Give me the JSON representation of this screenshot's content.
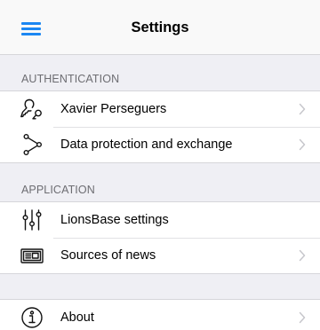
{
  "header": {
    "title": "Settings"
  },
  "sections": [
    {
      "title": "AUTHENTICATION",
      "items": [
        {
          "label": "Xavier Perseguers",
          "icon": "user-key-icon",
          "chevron": true
        },
        {
          "label": "Data protection and exchange",
          "icon": "share-nodes-icon",
          "chevron": true
        }
      ]
    },
    {
      "title": "APPLICATION",
      "items": [
        {
          "label": "LionsBase settings",
          "icon": "sliders-icon",
          "chevron": false
        },
        {
          "label": "Sources of news",
          "icon": "newspaper-icon",
          "chevron": true
        }
      ]
    },
    {
      "title": "",
      "items": [
        {
          "label": "About",
          "icon": "info-circle-icon",
          "chevron": true
        }
      ]
    }
  ],
  "colors": {
    "accent": "#1b87f2",
    "background": "#efeff4",
    "section_text": "#6d6d72",
    "chevron": "#c7c7cc"
  }
}
